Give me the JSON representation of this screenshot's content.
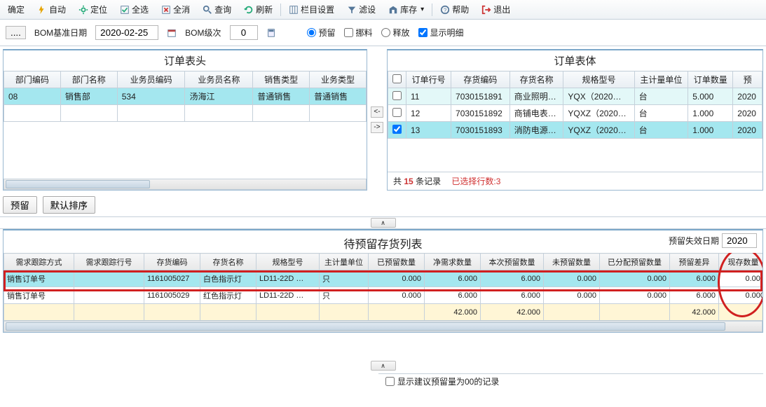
{
  "toolbar": {
    "confirm": "确定",
    "auto": "自动",
    "locate": "定位",
    "selall": "全选",
    "unsel": "全消",
    "query": "查询",
    "refresh": "刷新",
    "columns": "栏目设置",
    "filter": "滤设",
    "stock": "库存",
    "help": "帮助",
    "exit": "退出"
  },
  "params": {
    "bom_base_date_label": "BOM基准日期",
    "bom_base_date": "2020-02-25",
    "bom_level_label": "BOM级次",
    "bom_level": "0",
    "reserve": "预留",
    "scrap": "挪料",
    "release": "释放",
    "show_detail": "显示明细"
  },
  "head_panel": {
    "title": "订单表头",
    "cols": [
      "部门编码",
      "部门名称",
      "业务员编码",
      "业务员名称",
      "销售类型",
      "业务类型"
    ],
    "rows": [
      [
        "08",
        "销售部",
        "534",
        "汤海江",
        "普通销售",
        "普通销售"
      ]
    ]
  },
  "body_panel": {
    "title": "订单表体",
    "cols": [
      "",
      "订单行号",
      "存货编码",
      "存货名称",
      "规格型号",
      "主计量单位",
      "订单数量",
      "预"
    ],
    "rows": [
      {
        "chk": false,
        "cells": [
          "11",
          "7030151891",
          "商业照明…",
          "YQX（2020…",
          "台",
          "5.000",
          "2020"
        ]
      },
      {
        "chk": false,
        "cells": [
          "12",
          "7030151892",
          "商铺电表…",
          "YQXZ（2020…",
          "台",
          "1.000",
          "2020"
        ]
      },
      {
        "chk": true,
        "cells": [
          "13",
          "7030151893",
          "消防电源…",
          "YQXZ（2020…",
          "台",
          "1.000",
          "2020"
        ],
        "sel": true
      }
    ],
    "footer_total_prefix": "共",
    "footer_total_count": "15",
    "footer_total_suffix": "条记录",
    "footer_selected": "已选择行数:3"
  },
  "midbar": {
    "reserve": "预留",
    "sort": "默认排序"
  },
  "pending": {
    "title": "待预留存货列表",
    "expiry_label": "预留失效日期",
    "expiry_value": "2020",
    "cols": [
      "需求跟踪方式",
      "需求跟踪行号",
      "存货编码",
      "存货名称",
      "规格型号",
      "主计量单位",
      "已预留数量",
      "净需求数量",
      "本次预留数量",
      "未预留数量",
      "已分配预留数量",
      "预留差异",
      "现存数量"
    ],
    "rows": [
      {
        "sel": true,
        "cells": [
          "销售订单号",
          "",
          "1161005027",
          "白色指示灯",
          "LD11-22D …",
          "只",
          "0.000",
          "6.000",
          "6.000",
          "0.000",
          "0.000",
          "6.000",
          "0.000"
        ]
      },
      {
        "sel": false,
        "cells": [
          "销售订单号",
          "",
          "1161005029",
          "红色指示灯",
          "LD11-22D …",
          "只",
          "0.000",
          "6.000",
          "6.000",
          "0.000",
          "0.000",
          "6.000",
          "0.000"
        ]
      }
    ],
    "sum": [
      "",
      "",
      "",
      "",
      "",
      "",
      "",
      "42.000",
      "42.000",
      "",
      "",
      "42.000",
      ""
    ]
  },
  "bottom": {
    "hint": "显示建议预留量为00的记录"
  }
}
